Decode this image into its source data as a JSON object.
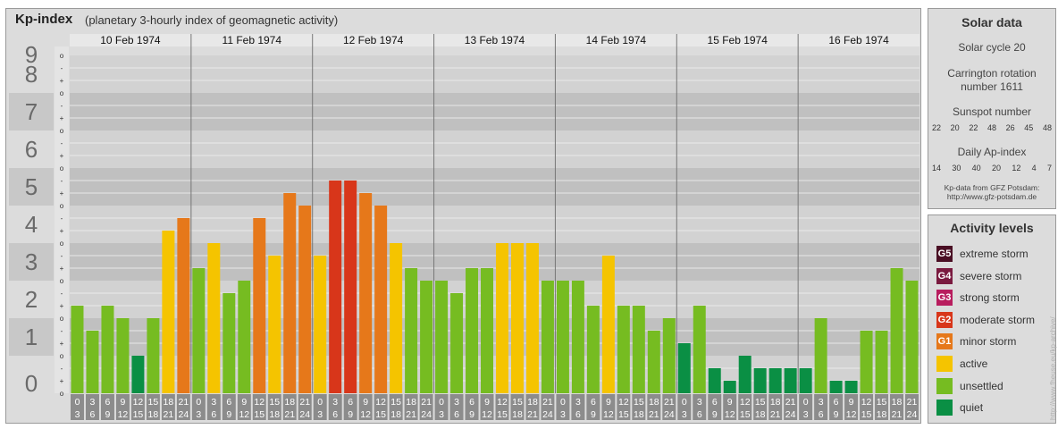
{
  "title": {
    "main": "Kp-index",
    "sub": "(planetary 3-hourly index of geomagnetic activity)"
  },
  "chart_data": {
    "type": "bar",
    "title": "Kp-index",
    "ylim": [
      0,
      9
    ],
    "y_ticks": [
      "0",
      "1",
      "2",
      "3",
      "4",
      "5",
      "6",
      "7",
      "8",
      "9"
    ],
    "minor_ticks": [
      "-",
      "o",
      "+"
    ],
    "days": [
      "10 Feb 1974",
      "11 Feb 1974",
      "12 Feb 1974",
      "13 Feb 1974",
      "14 Feb 1974",
      "15 Feb 1974",
      "16 Feb 1974"
    ],
    "hour_labels": [
      [
        "0",
        "3"
      ],
      [
        "3",
        "6"
      ],
      [
        "6",
        "9"
      ],
      [
        "9",
        "12"
      ],
      [
        "12",
        "15"
      ],
      [
        "15",
        "18"
      ],
      [
        "18",
        "21"
      ],
      [
        "21",
        "24"
      ]
    ],
    "kp_values": [
      [
        2.333,
        1.667,
        2.333,
        2.0,
        1.0,
        2.0,
        4.333,
        4.667
      ],
      [
        3.333,
        4.0,
        2.667,
        3.0,
        4.667,
        3.667,
        5.333,
        5.0
      ],
      [
        3.667,
        5.667,
        5.667,
        5.333,
        5.0,
        4.0,
        3.333,
        3.0
      ],
      [
        3.0,
        2.667,
        3.333,
        3.333,
        4.0,
        4.0,
        4.0,
        3.0
      ],
      [
        3.0,
        3.0,
        2.333,
        3.667,
        2.333,
        2.333,
        1.667,
        2.0
      ],
      [
        1.333,
        2.333,
        0.667,
        0.333,
        1.0,
        0.667,
        0.667,
        0.667
      ],
      [
        0.667,
        2.0,
        0.333,
        0.333,
        1.667,
        1.667,
        3.333,
        3.0
      ]
    ],
    "level_colors": {
      "quiet": "#0a8f44",
      "unsettled": "#76bc21",
      "active": "#f5c400",
      "minor_storm": "#e6781a",
      "moderate_storm": "#d8361a",
      "strong_storm": "#b81d5e",
      "severe_storm": "#7a1a3f",
      "extreme_storm": "#4a0f24"
    }
  },
  "solar": {
    "title": "Solar data",
    "cycle": "Solar cycle 20",
    "carrington_1": "Carrington rotation",
    "carrington_2": "number 1611",
    "sunspot_title": "Sunspot number",
    "sunspots": [
      "22",
      "20",
      "22",
      "48",
      "26",
      "45",
      "48"
    ],
    "ap_title": "Daily Ap-index",
    "ap": [
      "14",
      "30",
      "40",
      "20",
      "12",
      "4",
      "7"
    ],
    "source_1": "Kp-data from GFZ Potsdam:",
    "source_2": "http://www.gfz-potsdam.de"
  },
  "activity": {
    "title": "Activity levels",
    "items": [
      {
        "badge": "G5",
        "label": "extreme storm",
        "color": "#4a0f24"
      },
      {
        "badge": "G4",
        "label": "severe storm",
        "color": "#7a1a3f"
      },
      {
        "badge": "G3",
        "label": "strong storm",
        "color": "#b81d5e"
      },
      {
        "badge": "G2",
        "label": "moderate storm",
        "color": "#d8361a"
      },
      {
        "badge": "G1",
        "label": "minor storm",
        "color": "#e6781a"
      },
      {
        "badge": "",
        "label": "active",
        "color": "#f5c400"
      },
      {
        "badge": "",
        "label": "unsettled",
        "color": "#76bc21"
      },
      {
        "badge": "",
        "label": "quiet",
        "color": "#0a8f44"
      }
    ]
  },
  "watermark": "http://www.fheuse.eu/kp-archive/"
}
